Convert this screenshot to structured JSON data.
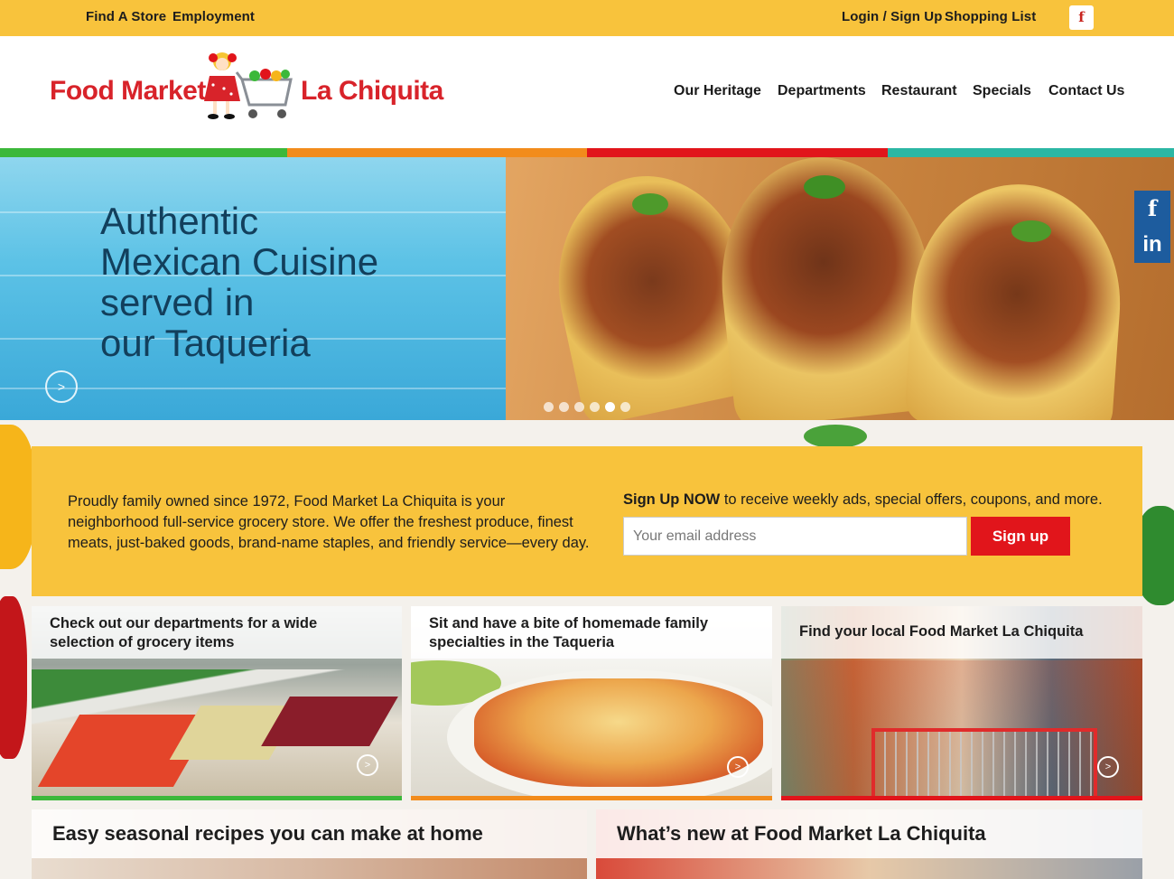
{
  "topbar": {
    "find_store": "Find A Store",
    "employment": "Employment",
    "login": "Login / Sign Up",
    "shopping_list": "Shopping List",
    "facebook_glyph": "f"
  },
  "logo": {
    "left_text": "Food Market",
    "right_text": "La Chiquita"
  },
  "nav": {
    "items": [
      "Our Heritage",
      "Departments",
      "Restaurant",
      "Specials",
      "Contact Us"
    ]
  },
  "colors": {
    "yellow": "#f8c33c",
    "green": "#3cb83a",
    "orange": "#f28c1c",
    "red": "#e1151b",
    "teal": "#2bb7a4",
    "brand_red": "#d8232a",
    "social_blue": "#1d5c9e"
  },
  "hero": {
    "line1": "Authentic",
    "line2": "Mexican Cuisine",
    "line3": "served in",
    "line4_prefix": "our ",
    "line4_emph": "Taqueria",
    "next_glyph": ">",
    "slide_count": 6,
    "active_slide": 5
  },
  "social": {
    "facebook": "f",
    "linkedin": "in"
  },
  "intro": {
    "text": "Proudly family owned since 1972, Food Market La Chiquita is your neighborhood full-service grocery store. We offer the freshest produce, finest meats, just-baked goods, brand-name staples, and friendly service—every day.",
    "signup_bold": "Sign Up NOW",
    "signup_rest": " to receive weekly ads, special offers, coupons, and more.",
    "email_placeholder": "Your email address",
    "button": "Sign up"
  },
  "cards": [
    {
      "caption": "Check out our departments for a wide selection of grocery items",
      "bar_color": "#3cb83a",
      "icon": "arrow-right-circle-icon"
    },
    {
      "caption": "Sit and have a bite of homemade family specialties in the Taqueria",
      "bar_color": "#f28c1c",
      "icon": "arrow-right-circle-icon"
    },
    {
      "caption": "Find your local Food Market La Chiquita",
      "bar_color": "#e1151b",
      "icon": "arrow-right-circle-icon"
    }
  ],
  "arrow_glyph": ">",
  "bottom_cards": [
    {
      "caption": "Easy seasonal recipes you can make at home"
    },
    {
      "caption": "What’s new at Food Market La Chiquita"
    }
  ]
}
